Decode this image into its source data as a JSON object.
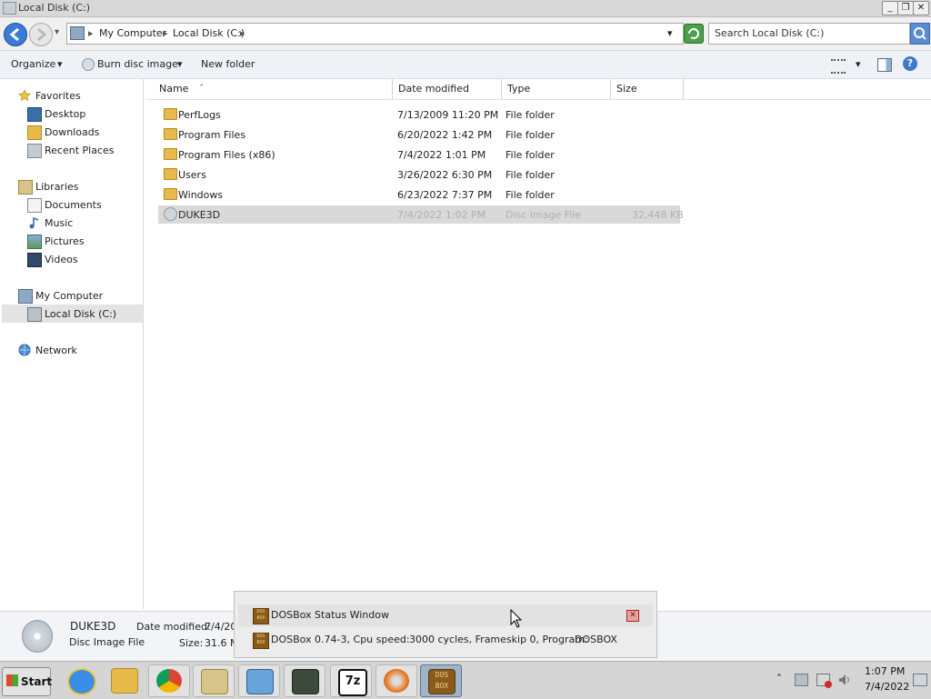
{
  "window": {
    "title": "Local Disk (C:)",
    "minimize_glyph": "_",
    "maximize_glyph": "❐",
    "close_glyph": "✕"
  },
  "address": {
    "crumbs": [
      "My Computer",
      "Local Disk (C:)"
    ],
    "sep": "▸",
    "dropdown": "▾"
  },
  "search": {
    "placeholder": "Search Local Disk (C:)"
  },
  "toolbar": {
    "organize": "Organize",
    "burn": "Burn disc image",
    "new_folder": "New folder",
    "dropdown": "▾",
    "help": "?"
  },
  "nav": {
    "favorites": {
      "label": "Favorites",
      "items": [
        "Desktop",
        "Downloads",
        "Recent Places"
      ]
    },
    "libraries": {
      "label": "Libraries",
      "items": [
        "Documents",
        "Music",
        "Pictures",
        "Videos"
      ]
    },
    "computer": {
      "label": "My Computer",
      "items": [
        "Local Disk (C:)"
      ]
    },
    "network": {
      "label": "Network"
    }
  },
  "columns": {
    "name": "Name",
    "date": "Date modified",
    "type": "Type",
    "size": "Size",
    "sort_glyph": "ˆ"
  },
  "files": [
    {
      "name": "PerfLogs",
      "date": "7/13/2009 11:20 PM",
      "type": "File folder",
      "size": ""
    },
    {
      "name": "Program Files",
      "date": "6/20/2022 1:42 PM",
      "type": "File folder",
      "size": ""
    },
    {
      "name": "Program Files (x86)",
      "date": "7/4/2022 1:01 PM",
      "type": "File folder",
      "size": ""
    },
    {
      "name": "Users",
      "date": "3/26/2022 6:30 PM",
      "type": "File folder",
      "size": ""
    },
    {
      "name": "Windows",
      "date": "6/23/2022 7:37 PM",
      "type": "File folder",
      "size": ""
    },
    {
      "name": "DUKE3D",
      "date": "7/4/2022 1:02 PM",
      "type": "Disc Image File",
      "size": "32,448 KB"
    }
  ],
  "details": {
    "name": "DUKE3D",
    "type": "Disc Image File",
    "date_label": "Date modified:",
    "date_value": "7/4/20",
    "size_label": "Size:",
    "size_value": "31.6 M"
  },
  "dosbox": {
    "title": "DOSBox Status Window",
    "close_glyph": "✕",
    "status": "DOSBox 0.74-3, Cpu speed:",
    "cycles": "3000 cycles, Frameskip  0, Program:",
    "program": "DOSBOX",
    "icon_text": "DOS BOX"
  },
  "taskbar": {
    "start": "Start",
    "sevenzip": "7z",
    "tray_up": "˄",
    "time": "1:07 PM",
    "date": "7/4/2022"
  }
}
